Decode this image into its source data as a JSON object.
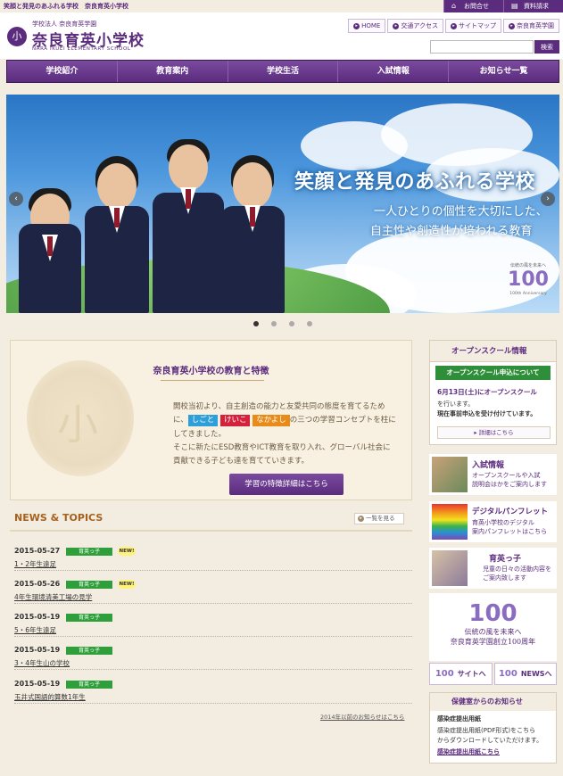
{
  "top": {
    "tagline": "笑顔と発見のあふれる学校　奈良育英小学校",
    "links": [
      {
        "label": "お問合せ",
        "icon": "house-icon"
      },
      {
        "label": "資料請求",
        "icon": "document-icon"
      }
    ]
  },
  "header": {
    "logo_small": "学校法人 奈良育英学園",
    "logo_main": "奈良育英小学校",
    "logo_en": "NARA IKUEI ELEMENTARY SCHOOL",
    "logo_char": "小",
    "sublinks": [
      "HOME",
      "交通アクセス",
      "サイトマップ",
      "奈良育英学園"
    ],
    "search_button": "検索"
  },
  "nav": [
    "学校紹介",
    "教育案内",
    "学校生活",
    "入試情報",
    "お知らせ一覧"
  ],
  "hero": {
    "title": "笑顔と発見のあふれる学校",
    "line1": "一人ひとりの個性を大切にした、",
    "line2": "自主性や創造性が培われる教育",
    "badge_small": "伝統の風を未来へ",
    "badge_num": "100",
    "badge_ann": "100th Anniversary",
    "prev": "‹",
    "next": "›",
    "slides": 4,
    "active_slide": 1
  },
  "feature": {
    "title": "奈良育英小学校の教育と特徴",
    "p1": "開校当初より、自主創造の能力と友愛共同の態度を育てるため",
    "p2_pre": "に、",
    "tag1": "しごと",
    "tag2": "けいこ",
    "tag3": "なかよし",
    "p2_post": "の三つの学習コンセプトを柱に",
    "p3": "してきました。",
    "p4": "そこに新たにESD教育やICT教育を取り入れ、グローバル社会に",
    "p5": "貢献できる子ども達を育てていきます。",
    "cta": "学習の特徴詳細はこちら",
    "crest_char": "小"
  },
  "news": {
    "heading": "NEWS & TOPICS",
    "more": "一覧を見る",
    "new_label": "NEW!",
    "items": [
      {
        "date": "2015-05-27",
        "cat": "育英っ子",
        "new": true,
        "title": "1・2年生遠足"
      },
      {
        "date": "2015-05-26",
        "cat": "育英っ子",
        "new": true,
        "title": "4年生環境清美工場の見学"
      },
      {
        "date": "2015-05-19",
        "cat": "育英っ子",
        "new": false,
        "title": "5・6年生遠足"
      },
      {
        "date": "2015-05-19",
        "cat": "育英っ子",
        "new": false,
        "title": "3・4年生山の学校"
      },
      {
        "date": "2015-05-19",
        "cat": "育英っ子",
        "new": false,
        "title": "玉井式国語的算数1年生"
      }
    ],
    "archive": "2014年以前のお知らせはこちら"
  },
  "sidebar": {
    "open_school": {
      "heading": "オープンスクール情報",
      "bar": "オープンスクール申込について",
      "t1": "6月13日(土)にオープンスクール",
      "t2a": "を行います。",
      "t2b": "現在事前申込を受け付けています。",
      "button": "詳細はこちら"
    },
    "cards": [
      {
        "title": "入試情報",
        "desc1": "オープンスクールや入試",
        "desc2": "説明会はかをご案内します"
      },
      {
        "title": "デジタルパンフレット",
        "desc1": "育英小学校のデジタル",
        "desc2": "案内パンフレットはこちら"
      },
      {
        "title": "育英っ子",
        "desc1": "児童の日々の活動内容を",
        "desc2": "ご案内致します"
      }
    ],
    "anniv": {
      "num": "100",
      "l1": "伝統の風を未来へ",
      "l2": "奈良育英学園創立100周年",
      "btn_site": "サイトへ",
      "btn_news": "NEWSへ"
    },
    "health": {
      "heading": "保健室からのお知らせ",
      "t1": "感染症提出用紙",
      "t2a": "感染症提出用紙(PDF形式)をこちら",
      "t2b": "からダウンロードしていただけます。",
      "link": "感染症提出用紙こちら"
    }
  },
  "colors": {
    "brand_purple": "#5b2c7e",
    "green": "#2e9f3a",
    "news_heading": "#a4621e"
  }
}
